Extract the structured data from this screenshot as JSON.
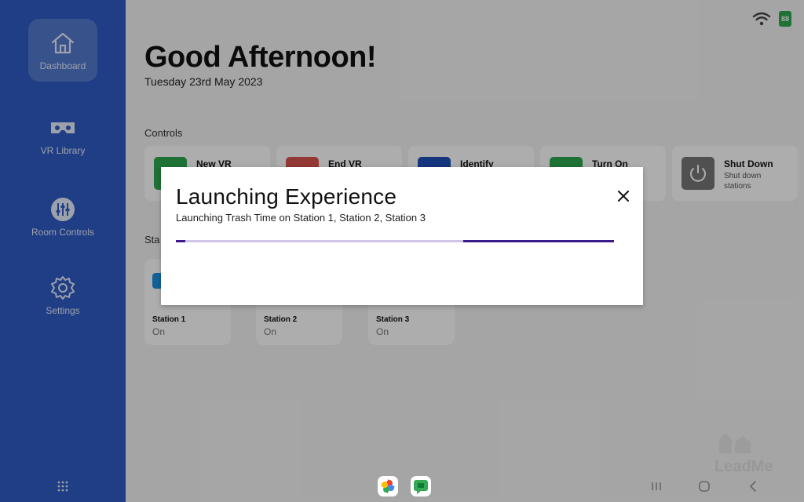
{
  "sidebar": {
    "items": [
      {
        "label": "Dashboard",
        "icon": "home-icon",
        "active": true
      },
      {
        "label": "VR Library",
        "icon": "vr-headset-icon"
      },
      {
        "label": "Room Controls",
        "icon": "sliders-icon"
      },
      {
        "label": "Settings",
        "icon": "gear-icon"
      }
    ]
  },
  "header": {
    "greeting": "Good Afternoon!",
    "date": "Tuesday 23rd May 2023"
  },
  "controls": {
    "label": "Controls",
    "cards": [
      {
        "title": "New VR",
        "subtitle": "",
        "color": "#2fa84f"
      },
      {
        "title": "End VR",
        "subtitle": "",
        "color": "#d9534f"
      },
      {
        "title": "Identify",
        "subtitle": "",
        "color": "#1f4fb8"
      },
      {
        "title": "Turn On",
        "subtitle": "",
        "color": "#2fa84f"
      },
      {
        "title": "Shut Down",
        "subtitle": "Shut down stations",
        "color": "#777777"
      }
    ]
  },
  "stations": {
    "label": "Sta",
    "cards": [
      {
        "name": "Station 1",
        "status": "On"
      },
      {
        "name": "Station 2",
        "status": "On"
      },
      {
        "name": "Station 3",
        "status": "On"
      }
    ]
  },
  "status_bar": {
    "battery": "88"
  },
  "modal": {
    "title": "Launching Experience",
    "subtitle": "Launching Trash Time on Station 1, Station 2, Station 3",
    "accent": "#3b1a8a"
  },
  "watermark": {
    "text": "LeadMe"
  },
  "dock": {
    "apps": [
      "photos-icon",
      "chat-icon"
    ]
  }
}
